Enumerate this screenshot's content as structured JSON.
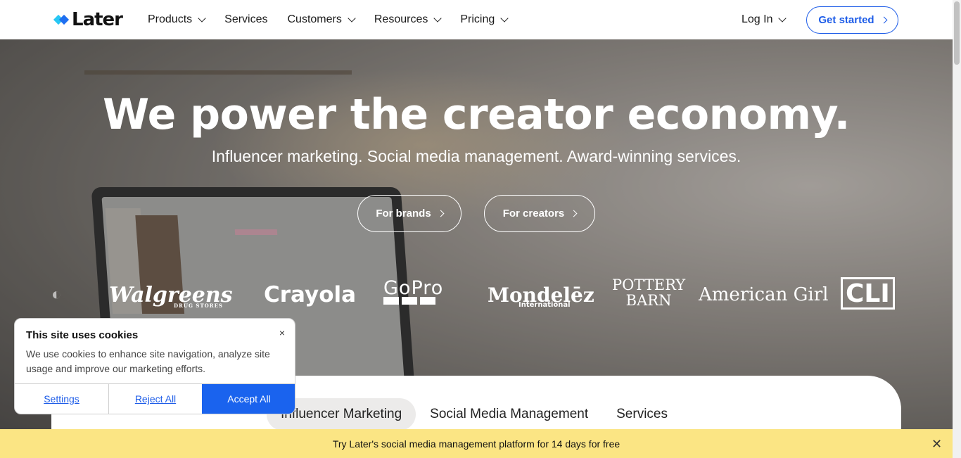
{
  "nav": {
    "logo": "Later",
    "items": [
      {
        "label": "Products",
        "dropdown": true
      },
      {
        "label": "Services",
        "dropdown": false
      },
      {
        "label": "Customers",
        "dropdown": true
      },
      {
        "label": "Resources",
        "dropdown": true
      },
      {
        "label": "Pricing",
        "dropdown": true
      }
    ],
    "login": "Log In",
    "cta": "Get started",
    "colors": {
      "brand_blue": "#1e5de8",
      "logo_light": "#27c7f4"
    }
  },
  "hero": {
    "title": "We power the creator economy.",
    "subtitle": "Influencer marketing. Social media management. Award-winning services.",
    "buttons": {
      "brands": "For brands",
      "creators": "For creators"
    }
  },
  "logos": {
    "walgreens": "Walgreens",
    "walgreens_sub": "DRUG STORES",
    "crayola": "Crayola",
    "gopro": "GoPro",
    "mondelez": "Mondelēz",
    "mondelez_sub": "International",
    "pottery": "POTTERY",
    "barn": "BARN",
    "american_girl": "American Girl",
    "cli": "CLI"
  },
  "tabs": [
    {
      "label": "Influencer Marketing",
      "active": true
    },
    {
      "label": "Social Media Management",
      "active": false
    },
    {
      "label": "Services",
      "active": false
    }
  ],
  "cookie": {
    "title": "This site uses cookies",
    "text": "We use cookies to enhance site navigation, analyze site usage and improve our marketing efforts.",
    "settings": "Settings",
    "reject": "Reject All",
    "accept": "Accept All",
    "close": "×"
  },
  "banner": {
    "text": "Try Later's social media management platform for 14 days for free",
    "close": "✕"
  }
}
